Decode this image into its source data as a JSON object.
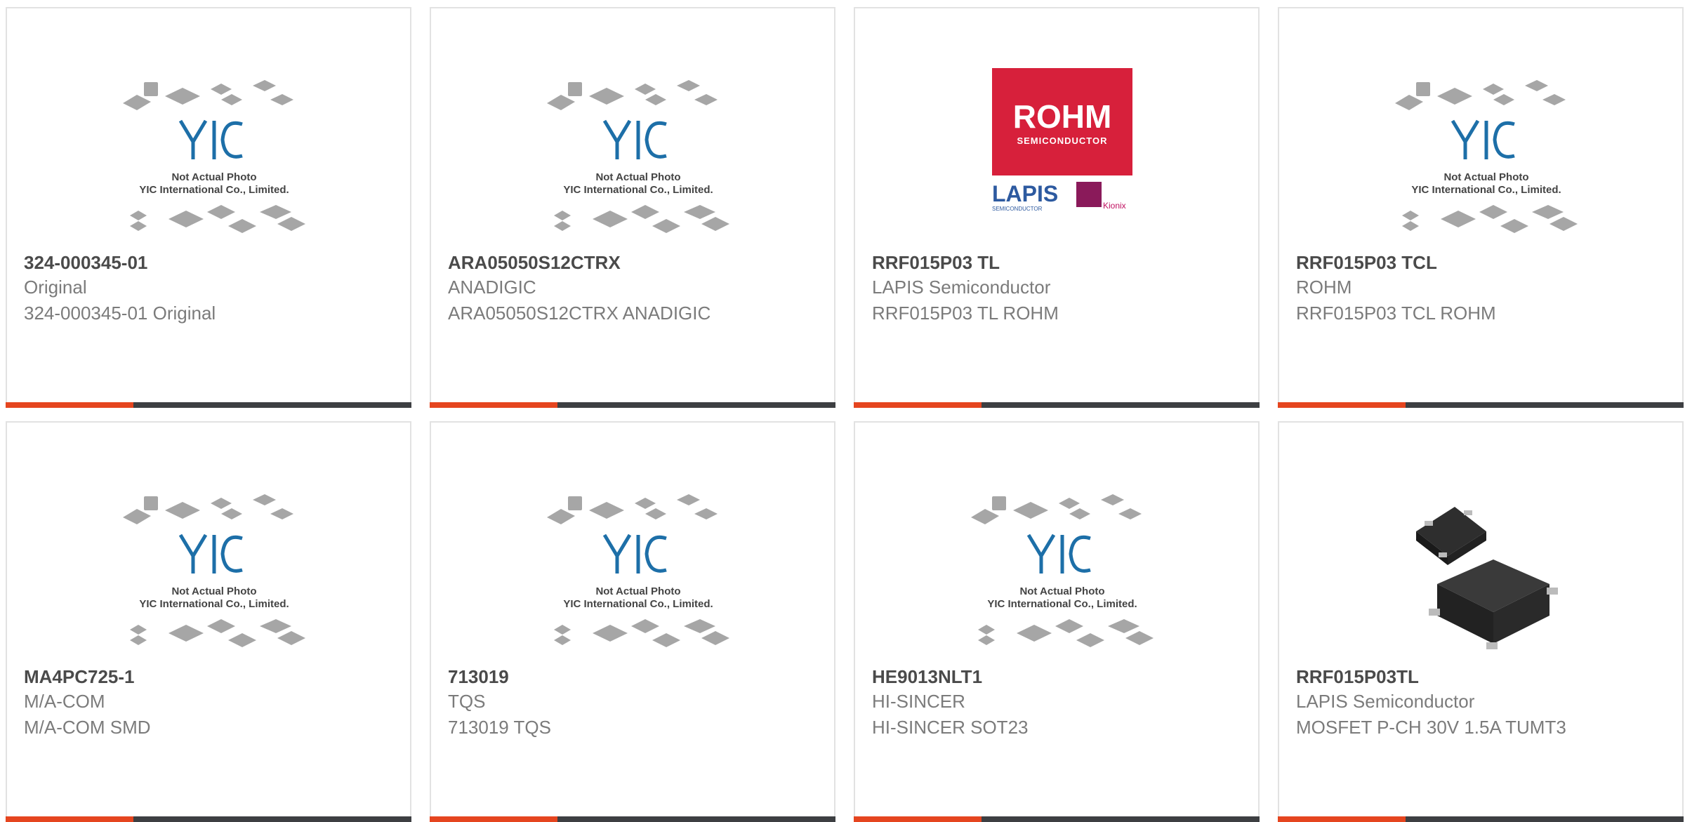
{
  "placeholder": {
    "line1": "Not Actual Photo",
    "line2": "YIC International Co., Limited."
  },
  "rohm_logo": {
    "brand": "ROHM",
    "sub": "SEMICONDUCTOR",
    "lapis": "LAPIS",
    "lapis_sub": "SEMICONDUCTOR",
    "kionix": "Kionix"
  },
  "colors": {
    "accent": "#e5451f",
    "bar": "#3d3f42",
    "border": "#e2e2e2",
    "yic_blue": "#1d6fa8",
    "rohm_red": "#d7203b"
  },
  "products": [
    {
      "part": "324-000345-01",
      "manufacturer": "Original",
      "description": "324-000345-01 Original",
      "image": "yic-placeholder"
    },
    {
      "part": "ARA05050S12CTRX",
      "manufacturer": "ANADIGIC",
      "description": "ARA05050S12CTRX ANADIGIC",
      "image": "yic-placeholder"
    },
    {
      "part": "RRF015P03 TL",
      "manufacturer": "LAPIS Semiconductor",
      "description": "RRF015P03 TL ROHM",
      "image": "rohm-logo"
    },
    {
      "part": "RRF015P03 TCL",
      "manufacturer": "ROHM",
      "description": "RRF015P03 TCL ROHM",
      "image": "yic-placeholder"
    },
    {
      "part": "MA4PC725-1",
      "manufacturer": "M/A-COM",
      "description": "M/A-COM SMD",
      "image": "yic-placeholder"
    },
    {
      "part": "713019",
      "manufacturer": "TQS",
      "description": "713019 TQS",
      "image": "yic-placeholder"
    },
    {
      "part": "HE9013NLT1",
      "manufacturer": "HI-SINCER",
      "description": "HI-SINCER SOT23",
      "image": "yic-placeholder"
    },
    {
      "part": "RRF015P03TL",
      "manufacturer": "LAPIS Semiconductor",
      "description": "MOSFET P-CH 30V 1.5A TUMT3",
      "image": "chip-photo"
    }
  ]
}
